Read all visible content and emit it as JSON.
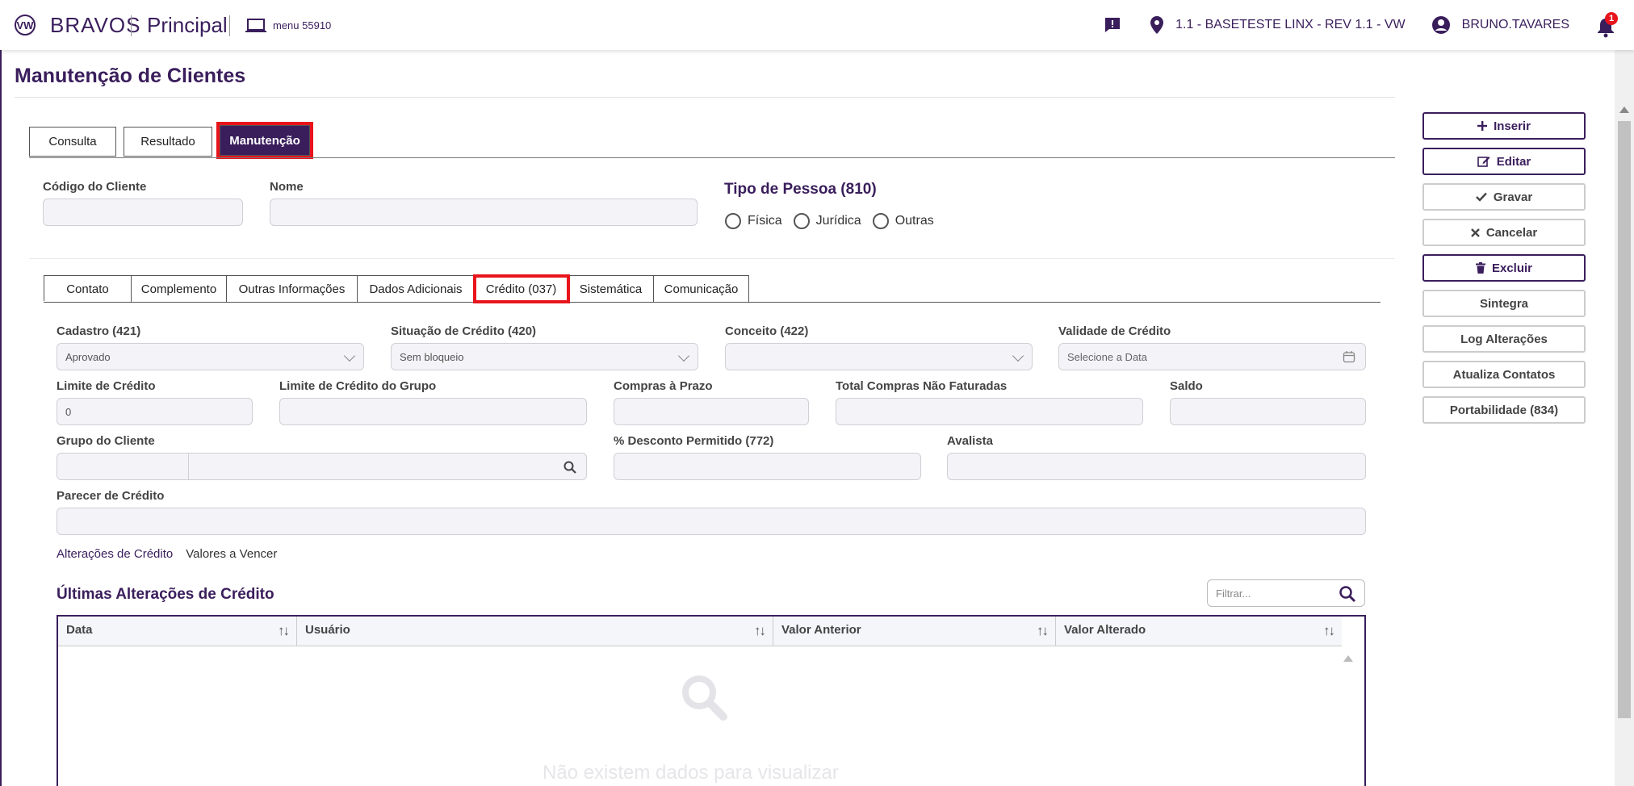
{
  "header": {
    "brand": "BRAVOS",
    "principal": "Principal",
    "menu_label": "menu 55910",
    "location": "1.1 - BASETESTE LINX - REV 1.1 - VW",
    "user": "BRUNO.TAVARES",
    "notification_count": "1",
    "logo_letters": "VW"
  },
  "page_title": "Manutenção de Clientes",
  "main_tabs": [
    {
      "label": "Consulta"
    },
    {
      "label": "Resultado"
    },
    {
      "label": "Manutenção",
      "active": true
    }
  ],
  "top_form": {
    "codigo_label": "Código do Cliente",
    "nome_label": "Nome",
    "tipo_pessoa_title": "Tipo de Pessoa (810)",
    "radio_options": [
      "Física",
      "Jurídica",
      "Outras"
    ]
  },
  "sub_tabs": [
    {
      "label": "Contato"
    },
    {
      "label": "Complemento"
    },
    {
      "label": "Outras Informações"
    },
    {
      "label": "Dados Adicionais"
    },
    {
      "label": "Crédito (037)",
      "active": true
    },
    {
      "label": "Sistemática"
    },
    {
      "label": "Comunicação"
    }
  ],
  "credito": {
    "cadastro_label": "Cadastro (421)",
    "cadastro_value": "Aprovado",
    "situacao_label": "Situação de Crédito (420)",
    "situacao_value": "Sem bloqueio",
    "conceito_label": "Conceito (422)",
    "conceito_value": "",
    "validade_label": "Validade de Crédito",
    "validade_placeholder": "Selecione a Data",
    "limite_label": "Limite de Crédito",
    "limite_value": "0",
    "limite_grupo_label": "Limite de Crédito do Grupo",
    "compras_prazo_label": "Compras à Prazo",
    "total_compras_label": "Total Compras Não Faturadas",
    "saldo_label": "Saldo",
    "grupo_label": "Grupo do Cliente",
    "desconto_label": "% Desconto Permitido (772)",
    "avalista_label": "Avalista",
    "parecer_label": "Parecer de Crédito"
  },
  "sub_links": [
    "Alterações de Crédito",
    "Valores a Vencer"
  ],
  "grid": {
    "title": "Últimas Alterações de Crédito",
    "filter_placeholder": "Filtrar...",
    "columns": [
      "Data",
      "Usuário",
      "Valor Anterior",
      "Valor Alterado"
    ],
    "empty_text": "Não existem dados para visualizar"
  },
  "side_buttons": [
    {
      "label": "Inserir",
      "icon": "plus-icon",
      "primary": true
    },
    {
      "label": "Editar",
      "icon": "edit-icon",
      "primary": true
    },
    {
      "label": "Gravar",
      "icon": "check-icon",
      "primary": false
    },
    {
      "label": "Cancelar",
      "icon": "x-icon",
      "primary": false
    },
    {
      "label": "Excluir",
      "icon": "trash-icon",
      "primary": true
    },
    {
      "label": "Sintegra",
      "icon": "",
      "primary": false
    },
    {
      "label": "Log Alterações",
      "icon": "",
      "primary": false
    },
    {
      "label": "Atualiza Contatos",
      "icon": "",
      "primary": false
    },
    {
      "label": "Portabilidade (834)",
      "icon": "",
      "primary": false
    }
  ],
  "colors": {
    "brand": "#3a1e5c",
    "highlight": "#e8141c"
  }
}
